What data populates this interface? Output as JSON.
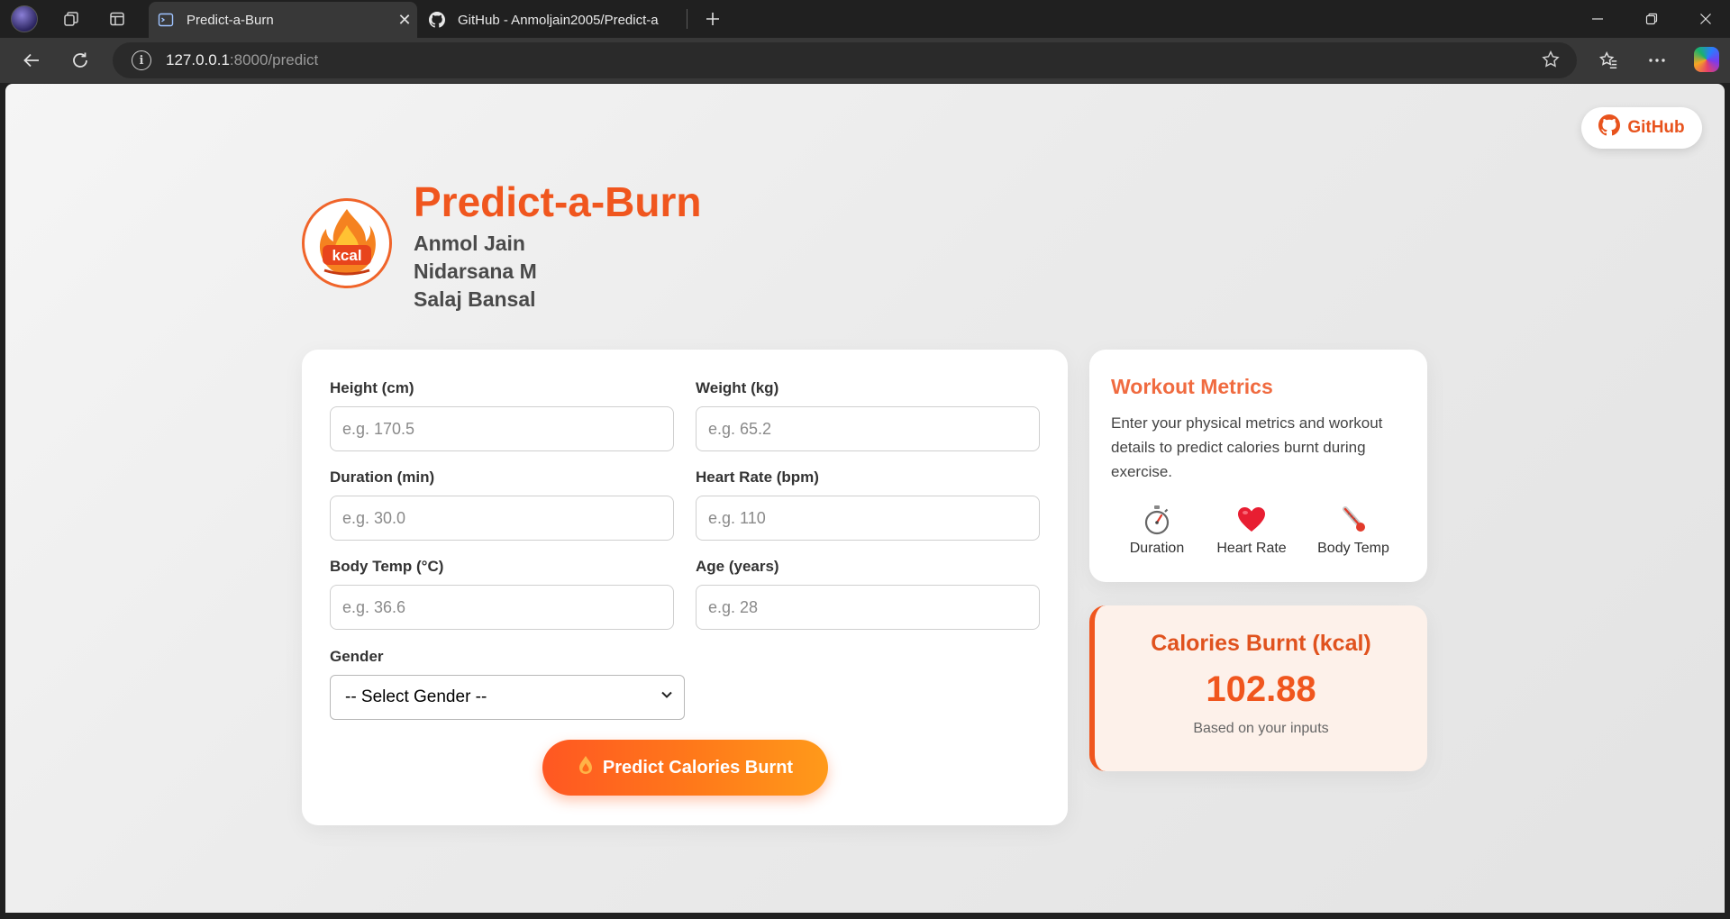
{
  "browser": {
    "tabs": [
      {
        "title": "Predict-a-Burn",
        "active": true
      },
      {
        "title": "GitHub - Anmoljain2005/Predict-a",
        "active": false
      }
    ],
    "url_host": "127.0.0.1",
    "url_path": ":8000/predict"
  },
  "header": {
    "github_label": "GitHub",
    "title": "Predict-a-Burn",
    "logo_text": "kcal",
    "authors": [
      "Anmol Jain",
      "Nidarsana M",
      "Salaj Bansal"
    ]
  },
  "form": {
    "fields": [
      {
        "label": "Height (cm)",
        "placeholder": "e.g. 170.5",
        "value": ""
      },
      {
        "label": "Weight (kg)",
        "placeholder": "e.g. 65.2",
        "value": ""
      },
      {
        "label": "Duration (min)",
        "placeholder": "e.g. 30.0",
        "value": ""
      },
      {
        "label": "Heart Rate (bpm)",
        "placeholder": "e.g. 110",
        "value": ""
      },
      {
        "label": "Body Temp (°C)",
        "placeholder": "e.g. 36.6",
        "value": ""
      },
      {
        "label": "Age (years)",
        "placeholder": "e.g. 28",
        "value": ""
      }
    ],
    "gender_label": "Gender",
    "gender_selected": "-- Select Gender --",
    "submit_label": "Predict Calories Burnt"
  },
  "metrics": {
    "title": "Workout Metrics",
    "description": "Enter your physical metrics and workout details to predict calories burnt during exercise.",
    "items": [
      {
        "label": "Duration",
        "icon": "stopwatch-icon"
      },
      {
        "label": "Heart Rate",
        "icon": "heart-icon"
      },
      {
        "label": "Body Temp",
        "icon": "thermometer-icon"
      }
    ]
  },
  "result": {
    "title": "Calories Burnt (kcal)",
    "value": "102.88",
    "note": "Based on your inputs"
  },
  "colors": {
    "accent": "#f0561e",
    "accent_light": "#ff9a1a",
    "result_bg": "#fdf1ea"
  }
}
